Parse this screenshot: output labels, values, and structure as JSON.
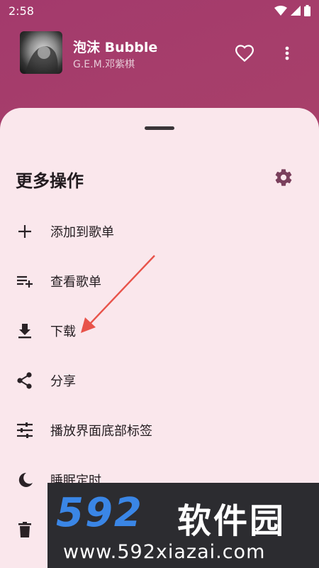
{
  "status_bar": {
    "time": "2:58"
  },
  "now_playing": {
    "title": "泡沫 Bubble",
    "artist": "G.E.M.邓紫棋"
  },
  "sheet": {
    "title": "更多操作",
    "items": [
      {
        "label": "添加到歌单",
        "icon": "add-icon"
      },
      {
        "label": "查看歌单",
        "icon": "playlist-add-icon"
      },
      {
        "label": "下载",
        "icon": "download-icon"
      },
      {
        "label": "分享",
        "icon": "share-icon"
      },
      {
        "label": "播放界面底部标签",
        "icon": "tune-icon"
      },
      {
        "label": "睡眠定时",
        "icon": "moon-icon"
      },
      {
        "label": "",
        "icon": "trash-icon"
      }
    ]
  },
  "watermark": {
    "number": "592",
    "name": "软件园",
    "url": "www.592xiazai.com"
  },
  "colors": {
    "accent": "#7a3f5c",
    "sheet_bg": "#fae7ec",
    "annotation_arrow": "#e8534a",
    "watermark_blue": "#3a86e6"
  }
}
